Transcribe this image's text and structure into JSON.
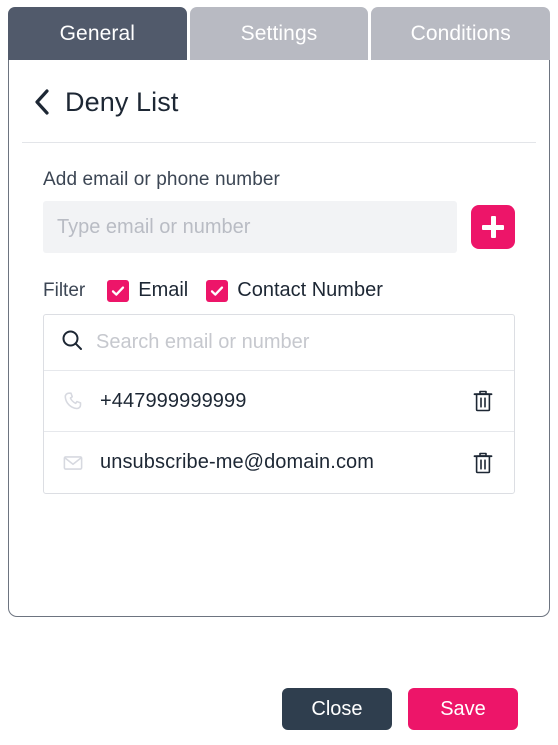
{
  "tabs": [
    {
      "label": "General",
      "active": true
    },
    {
      "label": "Settings",
      "active": false
    },
    {
      "label": "Conditions",
      "active": false
    }
  ],
  "header": {
    "back_icon": "chevron-left-icon",
    "title": "Deny List"
  },
  "add_section": {
    "label": "Add email or phone number",
    "input_value": "",
    "input_placeholder": "Type email or number",
    "add_button_icon": "plus-icon"
  },
  "filter": {
    "label": "Filter",
    "options": [
      {
        "label": "Email",
        "checked": true
      },
      {
        "label": "Contact Number",
        "checked": true
      }
    ]
  },
  "list": {
    "search_icon": "search-icon",
    "search_value": "",
    "search_placeholder": "Search email or number",
    "rows": [
      {
        "type_icon": "phone-icon",
        "value": "+447999999999",
        "delete_icon": "trash-icon"
      },
      {
        "type_icon": "envelope-icon",
        "value": "unsubscribe-me@domain.com",
        "delete_icon": "trash-icon"
      }
    ]
  },
  "footer": {
    "close_label": "Close",
    "save_label": "Save"
  },
  "colors": {
    "accent_pink": "#ED1569",
    "tab_active": "#515A6B",
    "tab_inactive": "#B8BAC2",
    "close_button": "#2F3E4E",
    "input_bg": "#F2F3F5"
  }
}
